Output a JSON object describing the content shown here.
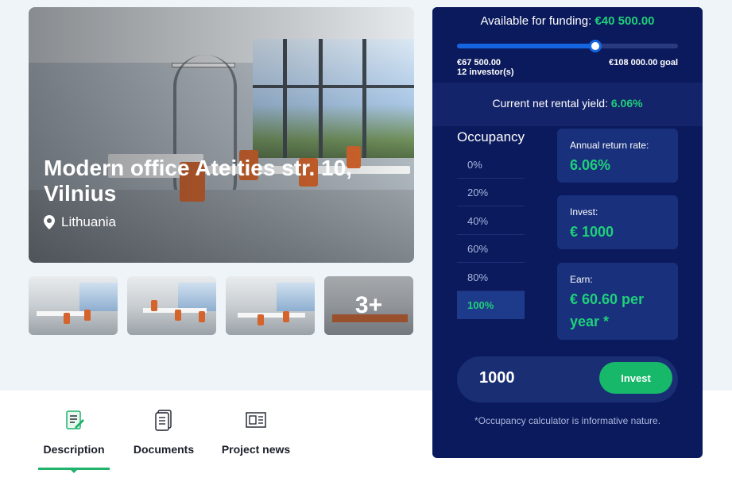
{
  "property": {
    "title": "Modern office Ateities str. 10, Vilnius",
    "location": "Lithuania",
    "more_photos": "3+"
  },
  "tabs": [
    {
      "label": "Description",
      "icon": "description-icon",
      "active": true
    },
    {
      "label": "Documents",
      "icon": "documents-icon",
      "active": false
    },
    {
      "label": "Project news",
      "icon": "project-news-icon",
      "active": false
    }
  ],
  "funding": {
    "label": "Available for funding:",
    "amount": "€40 500.00",
    "raised": "€67 500.00",
    "investors": "12 investor(s)",
    "goal": "€108 000.00 goal",
    "progress_fraction": 0.625
  },
  "yield": {
    "label": "Current net rental yield:",
    "value": "6.06%"
  },
  "occupancy": {
    "title": "Occupancy",
    "options": [
      "0%",
      "20%",
      "40%",
      "60%",
      "80%",
      "100%"
    ],
    "selected": "100%"
  },
  "stats": {
    "annual_label": "Annual return rate:",
    "annual_value": "6.06%",
    "invest_label": "Invest:",
    "invest_value": "€ 1000",
    "earn_label": "Earn:",
    "earn_value": "€ 60.60 per year *"
  },
  "invest": {
    "amount": "1000",
    "button": "Invest"
  },
  "note": "*Occupancy calculator is informative nature.",
  "colors": {
    "panel": "#0b1a5c",
    "accent_green": "#1fd07a",
    "progress_blue": "#1565e0"
  }
}
